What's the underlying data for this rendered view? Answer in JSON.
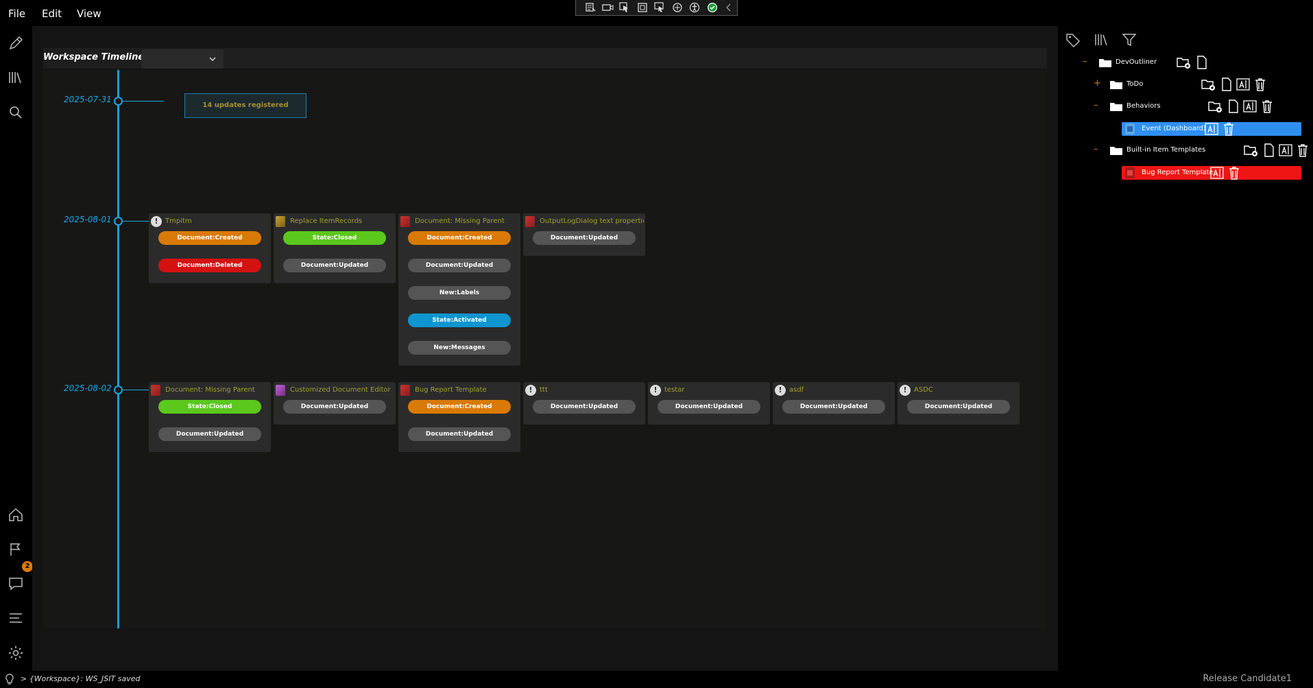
{
  "menu": {
    "file": "File",
    "edit": "Edit",
    "view": "View"
  },
  "devtools": [
    "inspect-icon",
    "record-icon",
    "pointer-icon",
    "frame-icon",
    "hover-icon",
    "hot-reload-icon",
    "accessibility-icon",
    "check-icon",
    "collapse-icon"
  ],
  "left_rail": [
    "edit-icon",
    "library-icon",
    "search-icon",
    "home-icon",
    "flag-icon",
    "chat-icon",
    "list-icon",
    "settings-icon"
  ],
  "notification_count": "2",
  "timeline": {
    "title": "Workspace Timeline",
    "select_value": "",
    "dates": [
      "2025-07-31",
      "2025-08-01",
      "2025-08-02"
    ],
    "summary": "14 updates registered",
    "rows": [
      [
        {
          "title": "Tmpitm",
          "icon": "info",
          "tags": [
            {
              "label": "Document:Created",
              "color": "orange"
            },
            {
              "label": "Document:Deleted",
              "color": "red"
            }
          ]
        },
        {
          "title": "Replace ItemRecords",
          "icon": "gold",
          "tags": [
            {
              "label": "State:Closed",
              "color": "green"
            },
            {
              "label": "Document:Updated",
              "color": "gray"
            }
          ]
        },
        {
          "title": "Document: Missing Parent",
          "icon": "red",
          "tags": [
            {
              "label": "Document:Created",
              "color": "orange"
            },
            {
              "label": "Document:Updated",
              "color": "gray"
            },
            {
              "label": "New:Labels",
              "color": "gray"
            },
            {
              "label": "State:Activated",
              "color": "blue"
            },
            {
              "label": "New:Messages",
              "color": "gray"
            }
          ]
        },
        {
          "title": "OutputLogDialog text properties",
          "icon": "red",
          "tags": [
            {
              "label": "Document:Updated",
              "color": "gray"
            }
          ]
        }
      ],
      [
        {
          "title": "Document: Missing Parent",
          "icon": "red",
          "tags": [
            {
              "label": "State:Closed",
              "color": "green"
            },
            {
              "label": "Document:Updated",
              "color": "gray"
            }
          ]
        },
        {
          "title": "Customized Document Editor",
          "icon": "purple",
          "tags": [
            {
              "label": "Document:Updated",
              "color": "gray"
            }
          ]
        },
        {
          "title": "Bug Report Template",
          "icon": "red",
          "tags": [
            {
              "label": "Document:Created",
              "color": "orange"
            },
            {
              "label": "Document:Updated",
              "color": "gray"
            }
          ]
        },
        {
          "title": "ttt",
          "icon": "info",
          "tags": [
            {
              "label": "Document:Updated",
              "color": "gray"
            }
          ]
        },
        {
          "title": "testar",
          "icon": "info",
          "tags": [
            {
              "label": "Document:Updated",
              "color": "gray"
            }
          ]
        },
        {
          "title": "asdf",
          "icon": "info",
          "tags": [
            {
              "label": "Document:Updated",
              "color": "gray"
            }
          ]
        },
        {
          "title": "ASDC",
          "icon": "info",
          "tags": [
            {
              "label": "Document:Updated",
              "color": "gray"
            }
          ]
        }
      ]
    ]
  },
  "outliner": {
    "top_icons": [
      "tag-icon",
      "library-icon",
      "filter-icon"
    ],
    "nodes": [
      {
        "label": "DevOutliner",
        "toggle": "–"
      },
      {
        "label": "ToDo",
        "toggle": "+"
      },
      {
        "label": "Behaviors",
        "toggle": "–"
      },
      {
        "label": "Event (Dashboard)",
        "highlight": "#2f8ff0"
      },
      {
        "label": "Built-in Item Templates",
        "toggle": "–"
      },
      {
        "label": "Bug Report Template",
        "highlight": "#ef1515"
      }
    ]
  },
  "status": {
    "message": "> {Workspace}: WS_JSIT saved",
    "release": "Release Candidate1"
  }
}
